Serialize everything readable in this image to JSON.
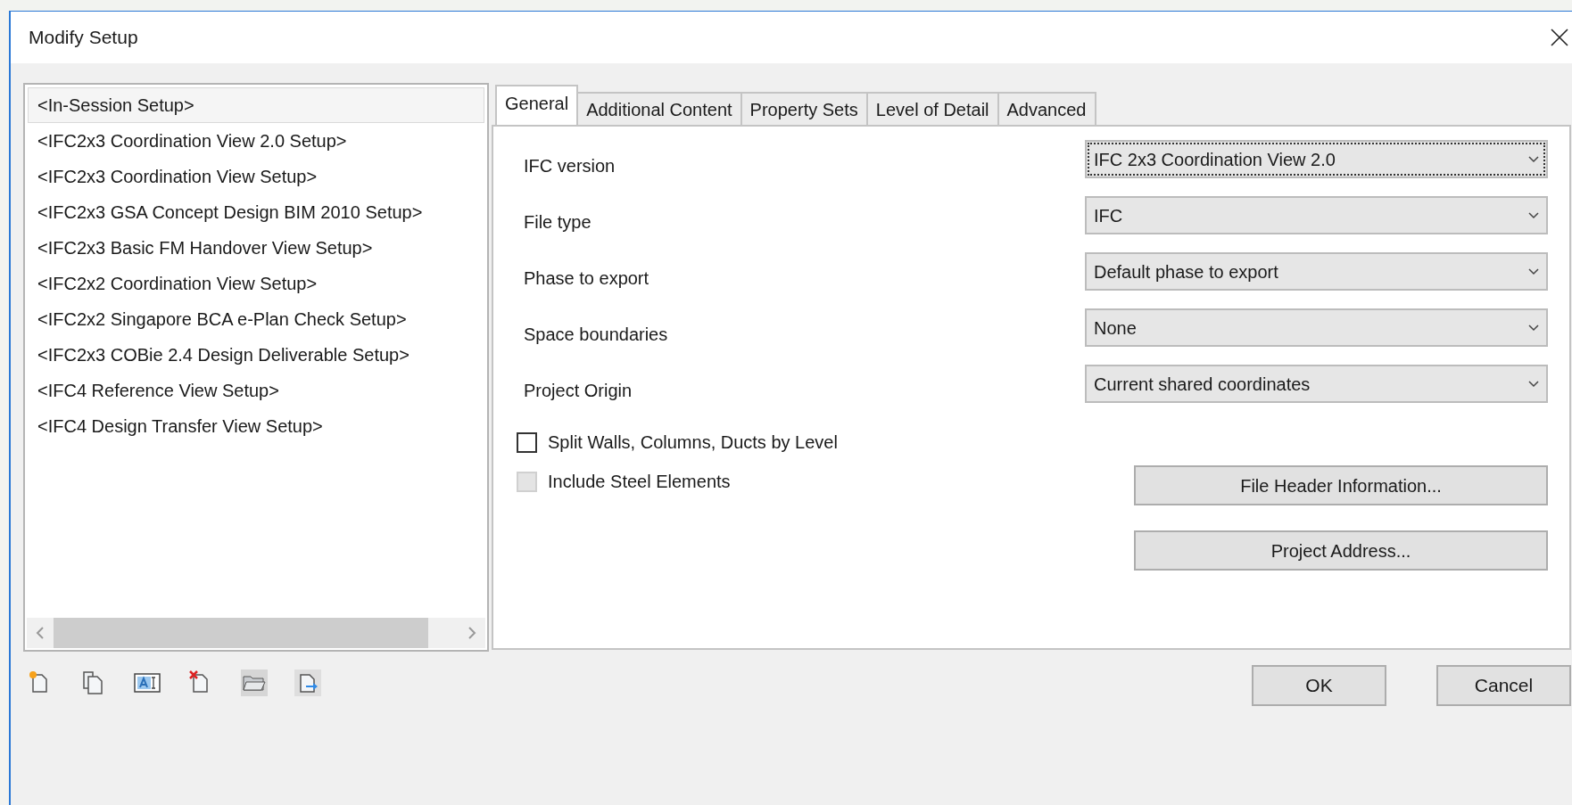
{
  "window": {
    "title": "Modify Setup"
  },
  "setups": [
    {
      "label": "<In-Session Setup>",
      "selected": true
    },
    {
      "label": "<IFC2x3 Coordination View 2.0 Setup>",
      "selected": false
    },
    {
      "label": "<IFC2x3 Coordination View Setup>",
      "selected": false
    },
    {
      "label": "<IFC2x3 GSA Concept Design BIM 2010 Setup>",
      "selected": false
    },
    {
      "label": "<IFC2x3 Basic FM Handover View Setup>",
      "selected": false
    },
    {
      "label": "<IFC2x2 Coordination View Setup>",
      "selected": false
    },
    {
      "label": "<IFC2x2 Singapore BCA e-Plan Check Setup>",
      "selected": false
    },
    {
      "label": "<IFC2x3 COBie 2.4 Design Deliverable Setup>",
      "selected": false
    },
    {
      "label": "<IFC4 Reference View Setup>",
      "selected": false
    },
    {
      "label": "<IFC4 Design Transfer View Setup>",
      "selected": false
    }
  ],
  "tabs": [
    {
      "label": "General",
      "selected": true
    },
    {
      "label": "Additional Content",
      "selected": false
    },
    {
      "label": "Property Sets",
      "selected": false
    },
    {
      "label": "Level of Detail",
      "selected": false
    },
    {
      "label": "Advanced",
      "selected": false
    }
  ],
  "fields": [
    {
      "label": "IFC version",
      "value": "IFC 2x3 Coordination View 2.0",
      "focused": true
    },
    {
      "label": "File type",
      "value": "IFC",
      "focused": false
    },
    {
      "label": "Phase to export",
      "value": "Default phase to export",
      "focused": false
    },
    {
      "label": "Space boundaries",
      "value": "None",
      "focused": false
    },
    {
      "label": "Project Origin",
      "value": "Current shared coordinates",
      "focused": false
    }
  ],
  "checkboxes": [
    {
      "label": "Split Walls, Columns, Ducts by Level",
      "checked": false,
      "disabled": false
    },
    {
      "label": "Include Steel Elements",
      "checked": false,
      "disabled": true
    }
  ],
  "panel_buttons": [
    "File Header Information...",
    "Project Address..."
  ],
  "dialog_buttons": [
    "OK",
    "Cancel"
  ]
}
